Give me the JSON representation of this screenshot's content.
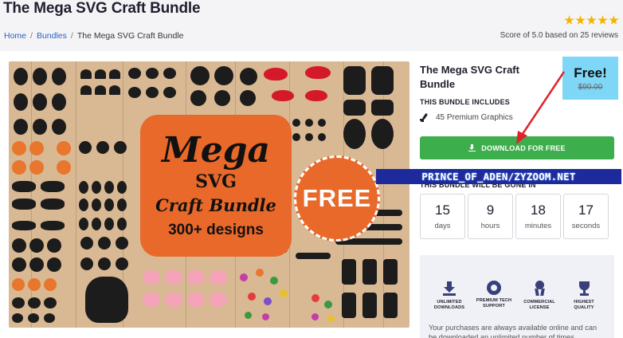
{
  "header": {
    "title": "The Mega SVG Craft Bundle",
    "rating_stars": 5,
    "score_text": "Score of 5.0 based on 25 reviews"
  },
  "breadcrumb": {
    "items": [
      "Home",
      "Bundles",
      "The Mega SVG Craft Bundle"
    ],
    "separator": "/"
  },
  "hero": {
    "line1": "Mega",
    "line2": "SVG",
    "line3": "Craft Bundle",
    "line4": "300+ designs",
    "badge": "FREE"
  },
  "sidebar": {
    "title": "The Mega SVG Craft Bundle",
    "price_label": "Free!",
    "old_price": "$90.00",
    "includes_label": "THIS BUNDLE INCLUDES",
    "graphics_count": "45 Premium Graphics",
    "download_button": "DOWNLOAD FOR FREE",
    "watermark": "PRINCE_OF_ADEN/ZYZOOM.NET",
    "gone_label": "THIS BUNDLE WILL BE GONE IN",
    "countdown": [
      {
        "value": "15",
        "unit": "days"
      },
      {
        "value": "9",
        "unit": "hours"
      },
      {
        "value": "18",
        "unit": "minutes"
      },
      {
        "value": "17",
        "unit": "seconds"
      }
    ],
    "features": [
      {
        "icon": "download-icon",
        "label_1": "UNLIMITED",
        "label_2": "DOWNLOADS"
      },
      {
        "icon": "lifebuoy-icon",
        "label_1": "PREMIUM TECH",
        "label_2": "SUPPORT"
      },
      {
        "icon": "award-icon",
        "label_1": "COMMERCIAL",
        "label_2": "LICENSE"
      },
      {
        "icon": "trophy-icon",
        "label_1": "HIGHEST",
        "label_2": "QUALITY"
      }
    ],
    "note": "Your purchases are always available online and can be downloaded an unlimited number of times."
  },
  "colors": {
    "accent_green": "#3cae4c",
    "free_box": "#7fd7f7",
    "hero_orange": "#e9692a",
    "star": "#f5b301",
    "arrow_red": "#e0232a",
    "watermark_bg": "#1d2a9c"
  }
}
